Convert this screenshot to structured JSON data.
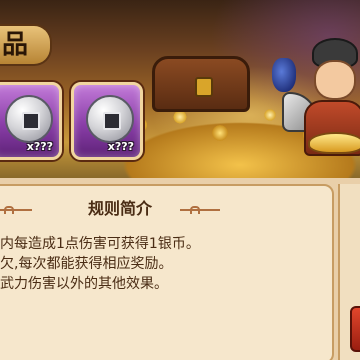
{
  "header": {
    "title_fragment": "品"
  },
  "rewards": [
    {
      "icon": "silver-coin-icon",
      "quantity": "x???"
    },
    {
      "icon": "silver-coin-icon",
      "quantity": "x???"
    }
  ],
  "rules_panel": {
    "heading": "规则简介",
    "lines": [
      "内每造成1点伤害可获得1银币。",
      "欠,每次都能获得相应奖励。",
      "武力伤害以外的其他效果。"
    ]
  },
  "colors": {
    "slot_purple": "#8a3ea8",
    "panel_bg": "#f6e7cc",
    "text_brown": "#4a2c14",
    "action_red": "#e2462c"
  }
}
